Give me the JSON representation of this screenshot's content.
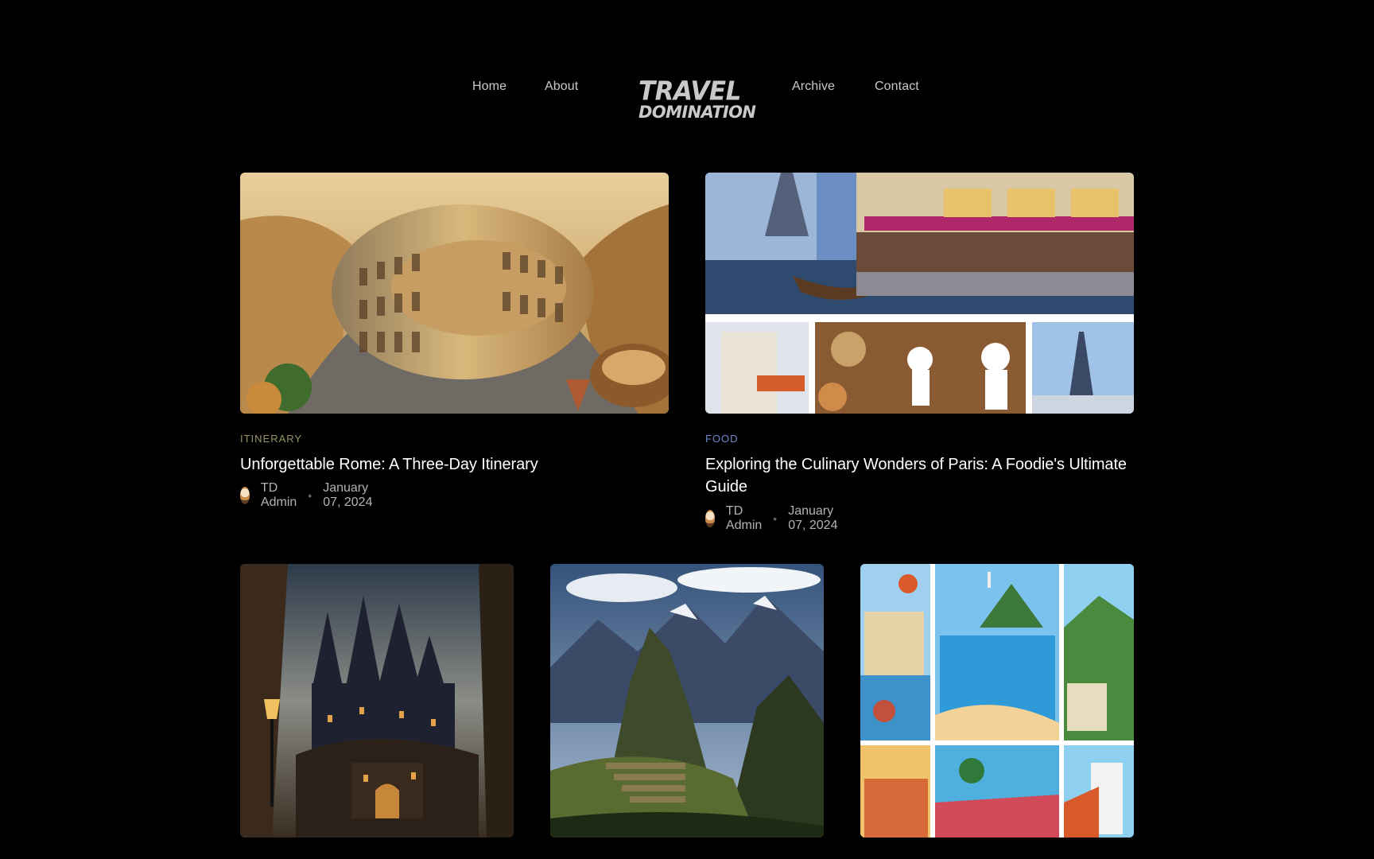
{
  "nav": {
    "left": [
      "Home",
      "About"
    ],
    "right": [
      "Archive",
      "Contact"
    ],
    "logo_line1": "TRAVEL",
    "logo_line2": "DOMINATION"
  },
  "colors": {
    "background": "#000000",
    "itinerary": "#9a9465",
    "food": "#6e86c9"
  },
  "featured": [
    {
      "category": "ITINERARY",
      "title": "Unforgettable Rome: A Three-Day Itinerary",
      "author": "TD Admin",
      "date": "January 07, 2024",
      "image_icon": "colosseum-illustration"
    },
    {
      "category": "FOOD",
      "title": "Exploring the Culinary Wonders of Paris: A Foodie's Ultimate Guide",
      "author": "TD Admin",
      "date": "January 07, 2024",
      "image_icon": "paris-collage-illustration"
    }
  ],
  "grid": [
    {
      "image_icon": "gothic-castle-illustration"
    },
    {
      "image_icon": "machu-picchu-illustration"
    },
    {
      "image_icon": "rio-collage-illustration"
    }
  ]
}
